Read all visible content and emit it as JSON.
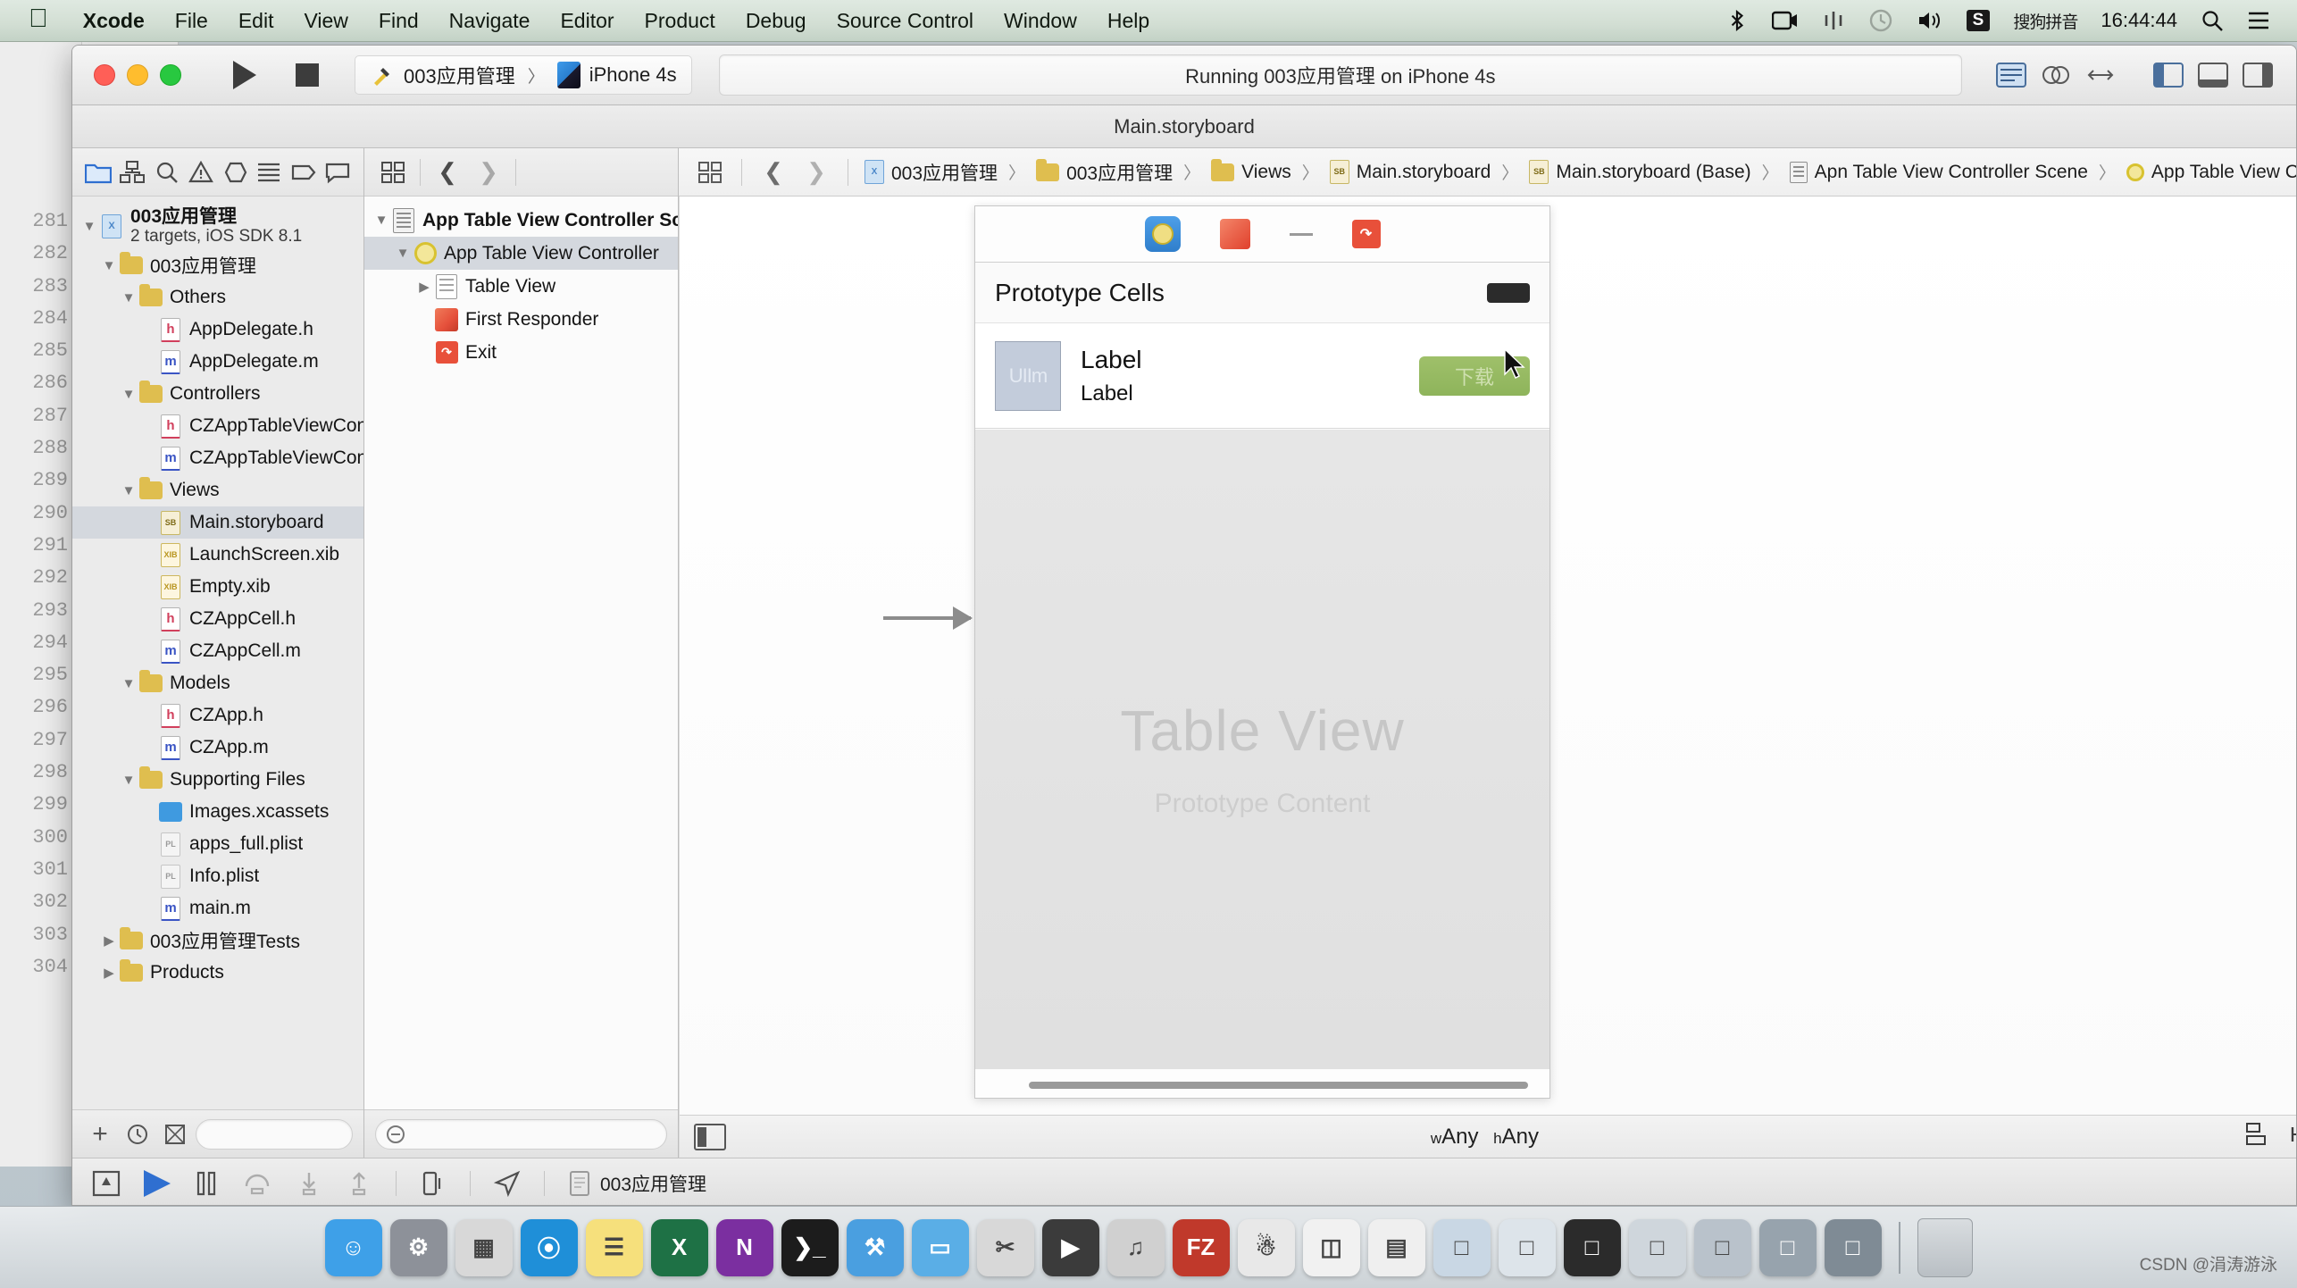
{
  "menubar": {
    "apple_icon": "apple-icon",
    "items": [
      {
        "label": "Xcode",
        "bold": true
      },
      {
        "label": "File",
        "bold": false
      },
      {
        "label": "Edit",
        "bold": false
      },
      {
        "label": "View",
        "bold": false
      },
      {
        "label": "Find",
        "bold": false
      },
      {
        "label": "Navigate",
        "bold": false
      },
      {
        "label": "Editor",
        "bold": false
      },
      {
        "label": "Product",
        "bold": false
      },
      {
        "label": "Debug",
        "bold": false
      },
      {
        "label": "Source Control",
        "bold": false
      },
      {
        "label": "Window",
        "bold": false
      },
      {
        "label": "Help",
        "bold": false
      }
    ],
    "status_items": [
      {
        "name": "bluetooth-icon",
        "glyph": "✦"
      },
      {
        "name": "screen-record-icon",
        "glyph": "▣"
      },
      {
        "name": "airplay-icon",
        "glyph": "⑂"
      },
      {
        "name": "timemachine-icon",
        "glyph": "◴"
      },
      {
        "name": "volume-icon",
        "glyph": "◀"
      }
    ],
    "ime_badge": "S",
    "ime_label": "搜狗拼音",
    "clock": "16:44:44",
    "search_icon": "search-icon",
    "notification_icon": "notification-center-icon"
  },
  "toolbar": {
    "run_button": "run-button",
    "stop_button": "stop-button",
    "scheme_project": "003应用管理",
    "scheme_separator": "〉",
    "scheme_device": "iPhone 4s",
    "status_text": "Running 003应用管理 on iPhone 4s",
    "right_buttons": [
      {
        "name": "editor-standard-button"
      },
      {
        "name": "editor-assistant-button"
      },
      {
        "name": "editor-version-button"
      },
      {
        "name": "view-navigator-button"
      },
      {
        "name": "view-debug-button"
      },
      {
        "name": "view-utilities-button"
      }
    ]
  },
  "document": {
    "title": "Main.storyboard"
  },
  "navigator": {
    "tabs": [
      {
        "name": "project-navigator-tab",
        "active": true
      },
      {
        "name": "symbol-navigator-tab",
        "active": false
      },
      {
        "name": "find-navigator-tab",
        "active": false
      },
      {
        "name": "issue-navigator-tab",
        "active": false
      },
      {
        "name": "test-navigator-tab",
        "active": false
      },
      {
        "name": "debug-navigator-tab",
        "active": false
      },
      {
        "name": "breakpoint-navigator-tab",
        "active": false
      },
      {
        "name": "report-navigator-tab",
        "active": false
      }
    ],
    "project": {
      "name": "003应用管理",
      "subtitle": "2 targets, iOS SDK 8.1"
    },
    "tree": [
      {
        "label": "003应用管理",
        "icon": "folder",
        "depth": 1,
        "twisty": "down",
        "selected": false
      },
      {
        "label": "Others",
        "icon": "folder",
        "depth": 2,
        "twisty": "down",
        "selected": false
      },
      {
        "label": "AppDelegate.h",
        "icon": "h",
        "depth": 3,
        "twisty": "",
        "selected": false
      },
      {
        "label": "AppDelegate.m",
        "icon": "m",
        "depth": 3,
        "twisty": "",
        "selected": false
      },
      {
        "label": "Controllers",
        "icon": "folder",
        "depth": 2,
        "twisty": "down",
        "selected": false
      },
      {
        "label": "CZAppTableViewController.h",
        "icon": "h",
        "depth": 3,
        "twisty": "",
        "selected": false
      },
      {
        "label": "CZAppTableViewController.m",
        "icon": "m",
        "depth": 3,
        "twisty": "",
        "selected": false
      },
      {
        "label": "Views",
        "icon": "folder",
        "depth": 2,
        "twisty": "down",
        "selected": false
      },
      {
        "label": "Main.storyboard",
        "icon": "sb",
        "depth": 3,
        "twisty": "",
        "selected": true
      },
      {
        "label": "LaunchScreen.xib",
        "icon": "xib",
        "depth": 3,
        "twisty": "",
        "selected": false
      },
      {
        "label": "Empty.xib",
        "icon": "xib",
        "depth": 3,
        "twisty": "",
        "selected": false
      },
      {
        "label": "CZAppCell.h",
        "icon": "h",
        "depth": 3,
        "twisty": "",
        "selected": false
      },
      {
        "label": "CZAppCell.m",
        "icon": "m",
        "depth": 3,
        "twisty": "",
        "selected": false
      },
      {
        "label": "Models",
        "icon": "folder",
        "depth": 2,
        "twisty": "down",
        "selected": false
      },
      {
        "label": "CZApp.h",
        "icon": "h",
        "depth": 3,
        "twisty": "",
        "selected": false
      },
      {
        "label": "CZApp.m",
        "icon": "m",
        "depth": 3,
        "twisty": "",
        "selected": false
      },
      {
        "label": "Supporting Files",
        "icon": "folder",
        "depth": 2,
        "twisty": "down",
        "selected": false
      },
      {
        "label": "Images.xcassets",
        "icon": "xcassets",
        "depth": 3,
        "twisty": "",
        "selected": false
      },
      {
        "label": "apps_full.plist",
        "icon": "plist",
        "depth": 3,
        "twisty": "",
        "selected": false
      },
      {
        "label": "Info.plist",
        "icon": "plist",
        "depth": 3,
        "twisty": "",
        "selected": false
      },
      {
        "label": "main.m",
        "icon": "m",
        "depth": 3,
        "twisty": "",
        "selected": false
      },
      {
        "label": "003应用管理Tests",
        "icon": "folder",
        "depth": 1,
        "twisty": "right",
        "selected": false
      },
      {
        "label": "Products",
        "icon": "folder",
        "depth": 1,
        "twisty": "right",
        "selected": false
      }
    ],
    "footer": {
      "add_button": "add-file-button",
      "recent_filter": "recent-files-filter-button",
      "source_control_filter": "source-control-filter-button",
      "filter_placeholder": ""
    }
  },
  "outline": {
    "toolbar": {
      "document_outline_button": "document-outline-button",
      "back_button": "navigate-back-button",
      "forward_button": "navigate-forward-button"
    },
    "tree": [
      {
        "label": "App Table View Controller Scene",
        "icon": "scene",
        "depth": 0,
        "twisty": "down",
        "bold": true,
        "selected": false
      },
      {
        "label": "App Table View Controller",
        "icon": "vc",
        "depth": 1,
        "twisty": "down",
        "bold": false,
        "selected": true
      },
      {
        "label": "Table View",
        "icon": "tableview",
        "depth": 2,
        "twisty": "right",
        "bold": false,
        "selected": false
      },
      {
        "label": "First Responder",
        "icon": "firstresponder",
        "depth": 2,
        "twisty": "",
        "bold": false,
        "selected": false
      },
      {
        "label": "Exit",
        "icon": "exit",
        "depth": 2,
        "twisty": "",
        "bold": false,
        "selected": false
      }
    ],
    "filter_placeholder": ""
  },
  "breadcrumb": {
    "items": [
      {
        "label": "003应用管理",
        "icon": "project-icon"
      },
      {
        "label": "003应用管理",
        "icon": "folder-icon"
      },
      {
        "label": "Views",
        "icon": "folder-icon"
      },
      {
        "label": "Main.storyboard",
        "icon": "storyboard-icon"
      },
      {
        "label": "Main.storyboard (Base)",
        "icon": "storyboard-icon"
      },
      {
        "label": "Apn Table View Controller Scene",
        "icon": "scene-icon"
      },
      {
        "label": "App Table View Controller",
        "icon": "viewcontroller-icon"
      }
    ],
    "separator": "〉"
  },
  "canvas": {
    "scene_dock": [
      {
        "name": "view-controller-dock-icon"
      },
      {
        "name": "first-responder-dock-icon"
      },
      {
        "name": "exit-dock-icon"
      }
    ],
    "prototype_cells_label": "Prototype Cells",
    "cell": {
      "image_placeholder": "UIIm",
      "label_1": "Label",
      "label_2": "Label",
      "button_label": "下载"
    },
    "table_ghost_title": "Table View",
    "table_ghost_sub": "Prototype Content",
    "footer": {
      "size_class_w": "w",
      "size_class_w_value": "Any",
      "size_class_h": "h",
      "size_class_h_value": "Any",
      "align_button": "align-button",
      "pin_button": "pin-button",
      "resolve_button": "resolve-auto-layout-button"
    }
  },
  "bottombar": {
    "buttons": [
      {
        "name": "show-debug-area-button"
      },
      {
        "name": "continue-button"
      },
      {
        "name": "pause-button"
      },
      {
        "name": "step-over-button"
      },
      {
        "name": "step-into-button"
      },
      {
        "name": "step-out-button"
      },
      {
        "name": "simulate-orientation-button"
      },
      {
        "name": "simulate-location-button"
      },
      {
        "name": "view-debug-hierarchy-button"
      }
    ],
    "process_label": "003应用管理"
  },
  "editor_background": {
    "line_numbers": [
      "281",
      "282",
      "283",
      "284",
      "285",
      "286",
      "287",
      "288",
      "289",
      "290",
      "291",
      "292",
      "293",
      "294",
      "295",
      "296",
      "297",
      "298",
      "299",
      "300",
      "301",
      "302",
      "303",
      "304"
    ]
  },
  "dock": {
    "items": [
      {
        "name": "finder-icon",
        "color": "#3ea0e8",
        "glyph": "☺"
      },
      {
        "name": "system-preferences-icon",
        "color": "#8d9199",
        "glyph": "⚙"
      },
      {
        "name": "launchpad-icon",
        "color": "#d8d8d8",
        "glyph": "▦"
      },
      {
        "name": "safari-icon",
        "color": "#1f8fd8",
        "glyph": "⦿"
      },
      {
        "name": "notes-icon",
        "color": "#f6e07c",
        "glyph": "☰"
      },
      {
        "name": "excel-icon",
        "color": "#1e7145",
        "glyph": "X"
      },
      {
        "name": "onenote-icon",
        "color": "#7b2fa0",
        "glyph": "N"
      },
      {
        "name": "terminal-icon",
        "color": "#1c1c1c",
        "glyph": "❯_"
      },
      {
        "name": "xcode-icon",
        "color": "#4a9fe0",
        "glyph": "⚒"
      },
      {
        "name": "folder-blue-icon",
        "color": "#5aaee6",
        "glyph": "▭"
      },
      {
        "name": "scissors-icon",
        "color": "#d8d8d8",
        "glyph": "✂"
      },
      {
        "name": "video-player-icon",
        "color": "#3b3b3b",
        "glyph": "▶"
      },
      {
        "name": "music-icon",
        "color": "#d0d0d0",
        "glyph": "♫"
      },
      {
        "name": "filezilla-icon",
        "color": "#c0392b",
        "glyph": "FZ"
      },
      {
        "name": "qq-icon",
        "color": "#e8e8e8",
        "glyph": "☃"
      },
      {
        "name": "preview-icon",
        "color": "#f1f1f1",
        "glyph": "◫"
      },
      {
        "name": "calculator-icon",
        "color": "#efefef",
        "glyph": "▤"
      },
      {
        "name": "window-1-icon",
        "color": "#c9d7e4",
        "glyph": "□"
      },
      {
        "name": "window-2-icon",
        "color": "#dde4ea",
        "glyph": "□"
      },
      {
        "name": "window-3-icon",
        "color": "#2b2b2b",
        "glyph": "□"
      },
      {
        "name": "window-4-icon",
        "color": "#cfd6dc",
        "glyph": "□"
      },
      {
        "name": "window-5-icon",
        "color": "#b9c2cb",
        "glyph": "□"
      },
      {
        "name": "window-6-icon",
        "color": "#97a3ad",
        "glyph": "□"
      },
      {
        "name": "window-7-icon",
        "color": "#7f8b95",
        "glyph": "□"
      }
    ],
    "trash": "trash-icon"
  },
  "watermark": "CSDN @涓涛游泳"
}
